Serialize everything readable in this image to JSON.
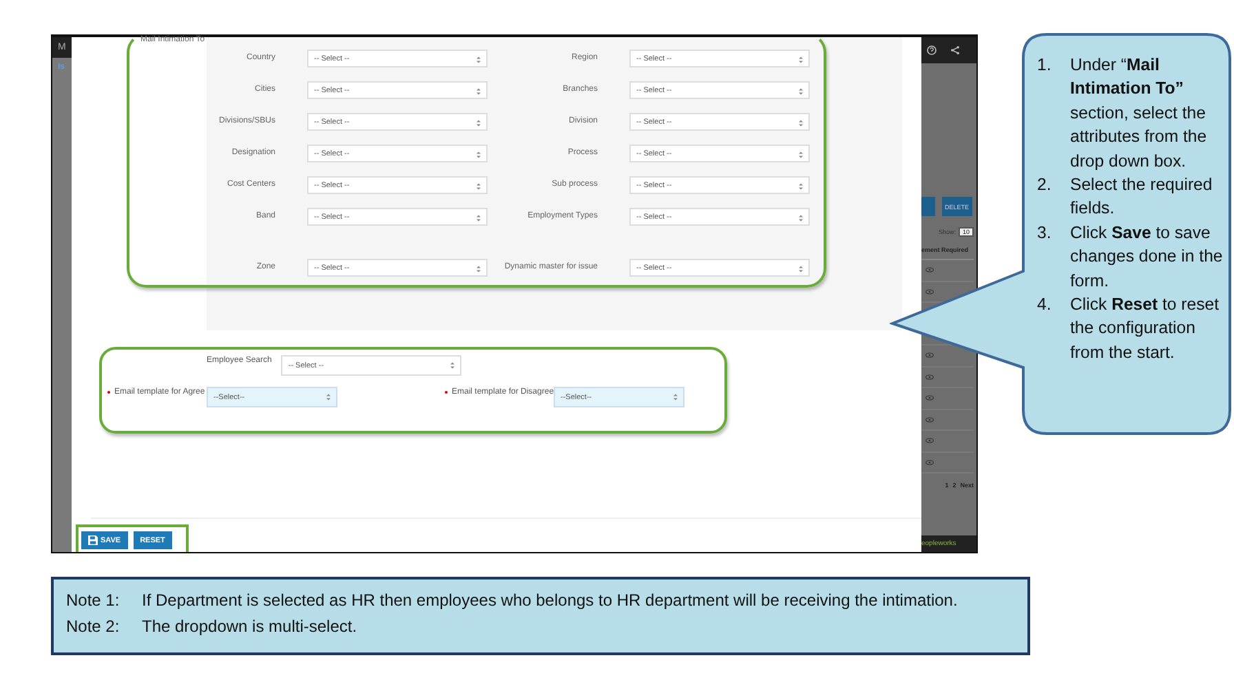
{
  "background_page": {
    "header_letter": "M",
    "link_text": "Is",
    "delete_button": "DELETE",
    "show_label": "Show:",
    "page_size": "10",
    "column_header": "ement Required",
    "pagination": [
      "1",
      "2",
      "Next"
    ],
    "footer_logo": "eopleworks"
  },
  "mail_intimation": {
    "legend": "Mail Intimation To",
    "fields": [
      {
        "label": "Country",
        "value": "-- Select --"
      },
      {
        "label": "Region",
        "value": "-- Select --"
      },
      {
        "label": "Cities",
        "value": "-- Select --"
      },
      {
        "label": "Branches",
        "value": "-- Select --"
      },
      {
        "label": "Divisions/SBUs",
        "value": "-- Select --"
      },
      {
        "label": "Division",
        "value": "-- Select --"
      },
      {
        "label": "Designation",
        "value": "-- Select --"
      },
      {
        "label": "Process",
        "value": "-- Select --"
      },
      {
        "label": "Cost Centers",
        "value": "-- Select --"
      },
      {
        "label": "Sub process",
        "value": "-- Select --"
      },
      {
        "label": "Band",
        "value": "-- Select --"
      },
      {
        "label": "Employment Types",
        "value": "-- Select --"
      },
      {
        "label": "Zone",
        "value": "-- Select --"
      },
      {
        "label": "Dynamic master for issue",
        "value": "-- Select --"
      }
    ]
  },
  "employee_search": {
    "label": "Employee Search",
    "value": "-- Select --"
  },
  "email_templates": [
    {
      "label": "Email template for Agree",
      "required": true,
      "value": "--Select--"
    },
    {
      "label": "Email template for Disagree",
      "required": true,
      "value": "--Select--"
    }
  ],
  "buttons": [
    {
      "kind": "save",
      "label": "SAVE"
    },
    {
      "kind": "reset",
      "label": "RESET"
    }
  ],
  "callout": {
    "steps": [
      {
        "number": "1.",
        "text": "Under “**Mail Intimation To”** section, select the attributes from the drop down box."
      },
      {
        "number": "2.",
        "text": "Select the required fields."
      },
      {
        "number": "3.",
        "text": "Click **Save** to save changes done in the form."
      },
      {
        "number": "4.",
        "text": "Click **Reset** to reset the configuration from the start."
      }
    ]
  },
  "notes": [
    {
      "label": "Note 1:",
      "text": "If Department is selected as HR then employees who belongs to HR department will be receiving the intimation."
    },
    {
      "label": "Note 2:",
      "text": "The dropdown is multi-select."
    }
  ]
}
